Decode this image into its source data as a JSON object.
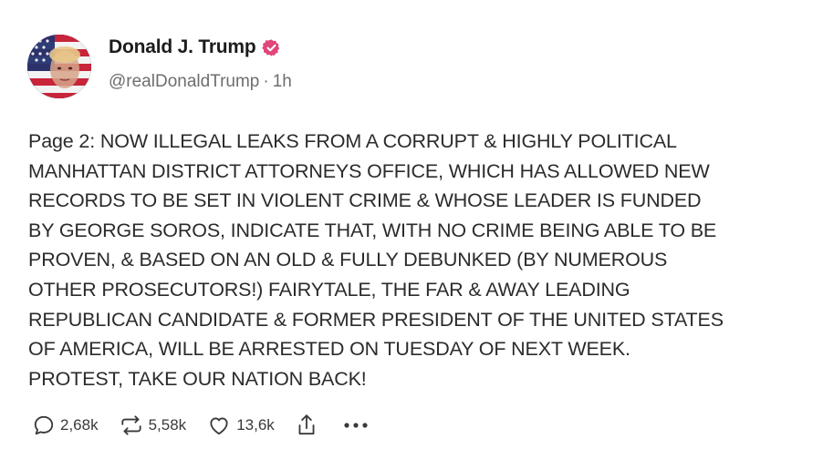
{
  "author": {
    "display_name": "Donald J. Trump",
    "handle": "@realDonaldTrump",
    "separator": "·",
    "time_ago": "1h",
    "verified_color": "#e0457b"
  },
  "post": {
    "text": "Page 2: NOW ILLEGAL LEAKS FROM A CORRUPT & HIGHLY POLITICAL\nMANHATTAN DISTRICT ATTORNEYS OFFICE, WHICH HAS ALLOWED NEW\nRECORDS TO BE SET IN VIOLENT CRIME & WHOSE LEADER IS FUNDED\nBY GEORGE SOROS, INDICATE THAT, WITH NO CRIME BEING ABLE TO BE\nPROVEN, & BASED ON AN OLD & FULLY DEBUNKED (BY NUMEROUS\nOTHER PROSECUTORS!) FAIRYTALE, THE FAR & AWAY LEADING\nREPUBLICAN CANDIDATE & FORMER PRESIDENT OF THE UNITED STATES\nOF AMERICA, WILL BE ARRESTED ON TUESDAY OF NEXT WEEK.\nPROTEST, TAKE OUR NATION BACK!"
  },
  "actions": {
    "replies": "2,68k",
    "reposts": "5,58k",
    "likes": "13,6k",
    "share_icon": "share-icon",
    "more_icon": "more-icon"
  }
}
